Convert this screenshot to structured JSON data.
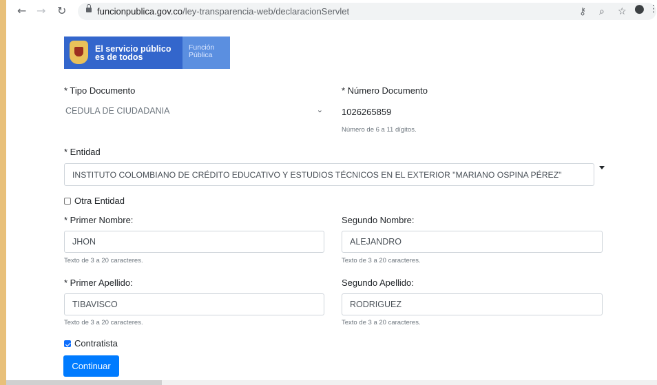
{
  "browser": {
    "url_domain": "funcionpublica.gov.co",
    "url_path": "/ley-transparencia-web/declaracionServlet",
    "back_icon": "arrow-left-icon",
    "forward_icon": "arrow-right-icon",
    "reload_icon": "reload-icon"
  },
  "logo": {
    "line1": "El servicio público",
    "line2": "es de todos",
    "right_line1": "Función",
    "right_line2": "Pública"
  },
  "form": {
    "tipo_documento_label": "* Tipo Documento",
    "tipo_documento_value": "CEDULA DE CIUDADANIA",
    "numero_documento_label": "* Número Documento",
    "numero_documento_value": "1026265859",
    "numero_documento_help": "Número de 6 a 11 dígitos.",
    "entidad_label": "* Entidad",
    "entidad_value": "INSTITUTO COLOMBIANO DE CRÉDITO EDUCATIVO Y ESTUDIOS TÉCNICOS EN EL EXTERIOR \"MARIANO OSPINA PÉREZ\"",
    "otra_entidad_label": "Otra Entidad",
    "otra_entidad_checked": false,
    "primer_nombre_label": "* Primer Nombre:",
    "primer_nombre_value": "JHON",
    "segundo_nombre_label": "Segundo Nombre:",
    "segundo_nombre_value": "ALEJANDRO",
    "primer_apellido_label": "* Primer Apellido:",
    "primer_apellido_value": "TIBAVISCO",
    "segundo_apellido_label": "Segundo Apellido:",
    "segundo_apellido_value": "RODRIGUEZ",
    "help_text": "Texto de 3 a 20 caracteres.",
    "contratista_label": "Contratista",
    "contratista_checked": true,
    "continuar_label": "Continuar"
  },
  "colors": {
    "primary": "#007bff",
    "logo_blue": "#3366cc",
    "stripe": "#e8c07a"
  }
}
